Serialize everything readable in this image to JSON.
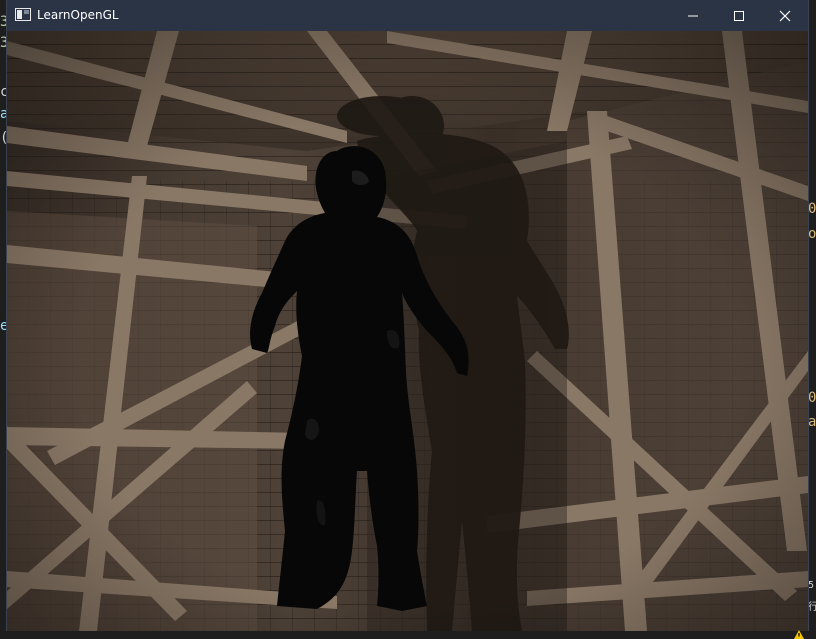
{
  "window": {
    "title": "LearnOpenGL",
    "icon": "app-window-icon",
    "controls": {
      "minimize_icon": "minimize-icon",
      "maximize_icon": "maximize-icon",
      "close_icon": "close-icon"
    }
  },
  "background_editor": {
    "left_edge_glyphs": [
      "3",
      "3",
      "c",
      "a",
      "(",
      "e"
    ],
    "right_edge_glyphs": [
      "0",
      "o",
      "0",
      "a",
      "5",
      "行"
    ]
  },
  "colors": {
    "titlebar": "#2b3445",
    "title_text": "#ffffff",
    "scene_wood": "#5a4a3c",
    "scene_beam": "#8a7866",
    "character_shadow": "#221b16",
    "character": "#070707",
    "warning_accent": "#f5c400"
  },
  "status": {
    "warning_icon": "warning-icon"
  }
}
